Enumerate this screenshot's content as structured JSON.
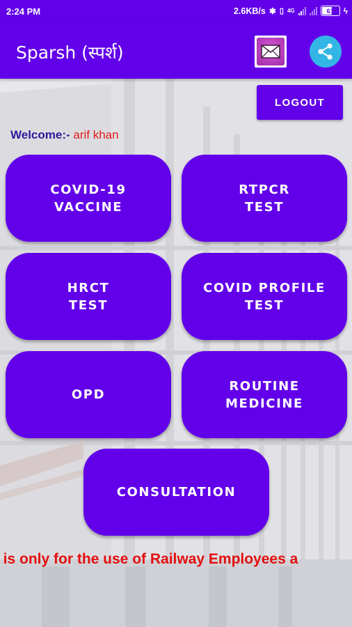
{
  "status_bar": {
    "time": "2:24 PM",
    "speed": "2.6KB/s",
    "battery": "61"
  },
  "app_bar": {
    "title": "Sparsh (स्पर्श)",
    "mail_icon": "mail-icon",
    "share_icon": "share-icon"
  },
  "logout_label": "LOGOUT",
  "welcome": {
    "label": "Welcome:-",
    "name": "arif khan"
  },
  "tiles": [
    {
      "label": "COVID-19\nVACCINE"
    },
    {
      "label": "RTPCR\nTEST"
    },
    {
      "label": "HRCT\nTEST"
    },
    {
      "label": "COVID PROFILE\nTEST"
    },
    {
      "label": "OPD"
    },
    {
      "label": "ROUTINE\nMEDICINE"
    },
    {
      "label": "CONSULTATION"
    }
  ],
  "marquee": "p is only for the use of Railway Employees a",
  "colors": {
    "primary": "#6200ea",
    "welcome_label": "#2a1a99",
    "welcome_name": "#e01b1b",
    "marquee": "#e30f0f",
    "share_bg": "#33b5e5"
  }
}
